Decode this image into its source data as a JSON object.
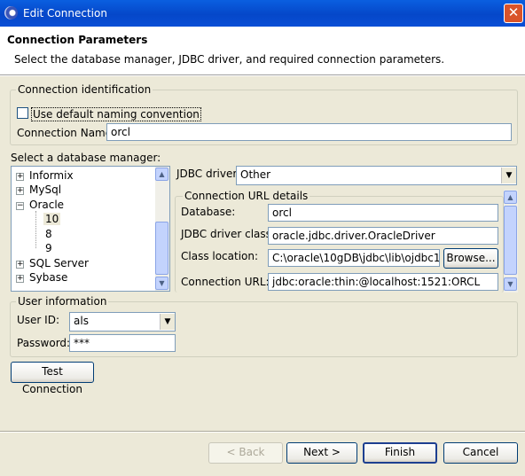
{
  "window": {
    "title": "Edit Connection",
    "close_label": "✕"
  },
  "header": {
    "title": "Connection Parameters",
    "description": "Select the database manager, JDBC driver, and required connection parameters."
  },
  "identification": {
    "legend": "Connection identification",
    "use_default_label": "Use default naming convention",
    "use_default_checked": false,
    "connection_name_label": "Connection Name:",
    "connection_name_value": "orcl"
  },
  "db_manager": {
    "label": "Select a database manager:",
    "tree": [
      {
        "label": "Informix",
        "expander": "+"
      },
      {
        "label": "MySql",
        "expander": "+"
      },
      {
        "label": "Oracle",
        "expander": "−"
      },
      {
        "label": "10"
      },
      {
        "label": "8"
      },
      {
        "label": "9"
      },
      {
        "label": "SQL Server",
        "expander": "+"
      },
      {
        "label": "Sybase",
        "expander": "+"
      }
    ],
    "selected": "10"
  },
  "jdbc": {
    "driver_label": "JDBC driver:",
    "driver_value": "Other"
  },
  "url_details": {
    "legend": "Connection URL details",
    "database_label": "Database:",
    "database_value": "orcl",
    "driver_class_label": "JDBC driver class:",
    "driver_class_value": "oracle.jdbc.driver.OracleDriver",
    "class_location_label": "Class location:",
    "class_location_value": "C:\\oracle\\10gDB\\jdbc\\lib\\ojdbc14.j",
    "browse_label": "Browse...",
    "connection_url_label": "Connection URL:",
    "connection_url_value": "jdbc:oracle:thin:@localhost:1521:ORCL"
  },
  "user_info": {
    "legend": "User information",
    "user_id_label": "User ID:",
    "user_id_value": "als",
    "password_label": "Password:",
    "password_value": "***"
  },
  "buttons": {
    "test_connection": "Test Connection",
    "back": "< Back",
    "next": "Next >",
    "finish": "Finish",
    "cancel": "Cancel"
  },
  "scroll_arrows": {
    "up": "▲",
    "down": "▼"
  }
}
